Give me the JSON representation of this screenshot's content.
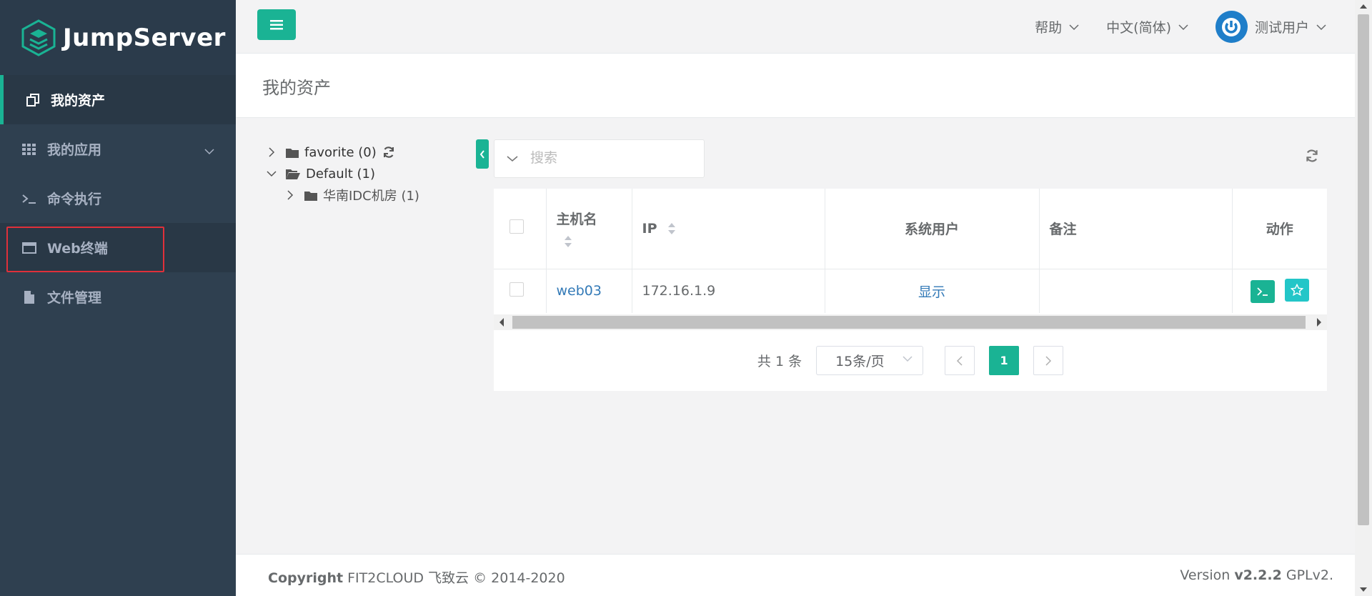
{
  "app": {
    "logo_text": "JumpServer"
  },
  "sidebar": {
    "items": [
      {
        "label": "我的资产",
        "icon": "assets-icon"
      },
      {
        "label": "我的应用",
        "icon": "grid-icon"
      },
      {
        "label": "命令执行",
        "icon": "terminal-icon"
      },
      {
        "label": "Web终端",
        "icon": "window-icon"
      },
      {
        "label": "文件管理",
        "icon": "file-icon"
      }
    ]
  },
  "topbar": {
    "help": "帮助",
    "language": "中文(简体)",
    "user": "测试用户"
  },
  "page": {
    "title": "我的资产"
  },
  "tree": {
    "nodes": [
      {
        "label": "favorite (0)"
      },
      {
        "label": "Default (1)"
      },
      {
        "label": "华南IDC机房 (1)"
      }
    ]
  },
  "search": {
    "placeholder": "搜索"
  },
  "table": {
    "headers": {
      "hostname": "主机名",
      "ip": "IP",
      "system_user": "系统用户",
      "comment": "备注",
      "action": "动作"
    },
    "rows": [
      {
        "hostname": "web03",
        "ip": "172.16.1.9",
        "system_user": "显示",
        "comment": ""
      }
    ]
  },
  "pagination": {
    "total": "共 1 条",
    "page_size": "15条/页",
    "current_page": "1"
  },
  "footer": {
    "copyright_label": "Copyright",
    "copyright_text": "FIT2CLOUD 飞致云 © 2014-2020",
    "version_label": "Version",
    "version": "v2.2.2",
    "license": "GPLv2."
  },
  "colors": {
    "accent": "#1ab394",
    "sidebar": "#2f4050",
    "link": "#337ab7",
    "highlight_box": "#e0303a",
    "star_button": "#23c6c8"
  }
}
